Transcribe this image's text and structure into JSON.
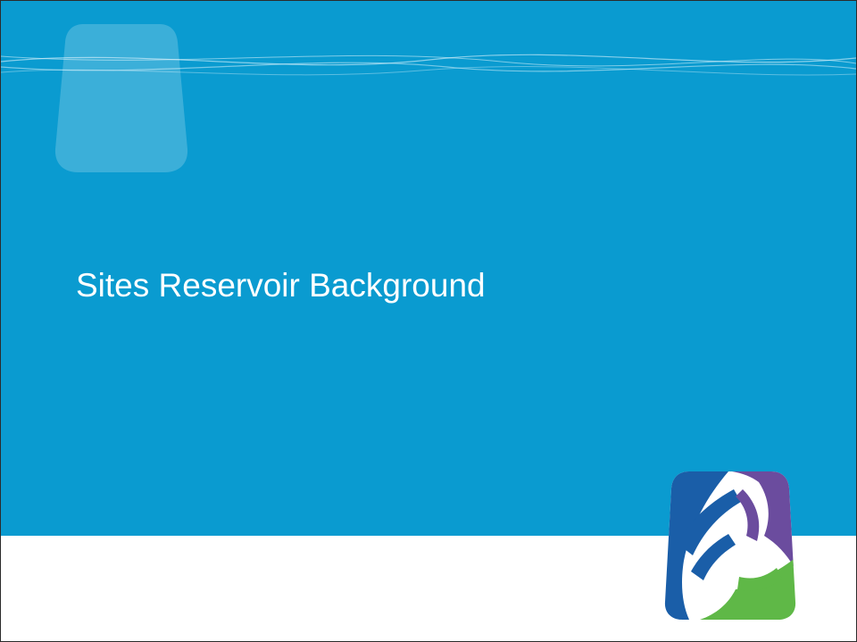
{
  "slide": {
    "title": "Sites Reservoir Background"
  },
  "colors": {
    "background_blue": "#0a9bd0",
    "footer_white": "#ffffff",
    "title_text": "#ffffff",
    "logo_blue": "#1a5ea8",
    "logo_purple": "#6b4c9e",
    "logo_green": "#5fb847"
  },
  "icons": {
    "logo": "sites-reservoir-logo-icon",
    "decoration": "water-drop-shape-icon"
  }
}
